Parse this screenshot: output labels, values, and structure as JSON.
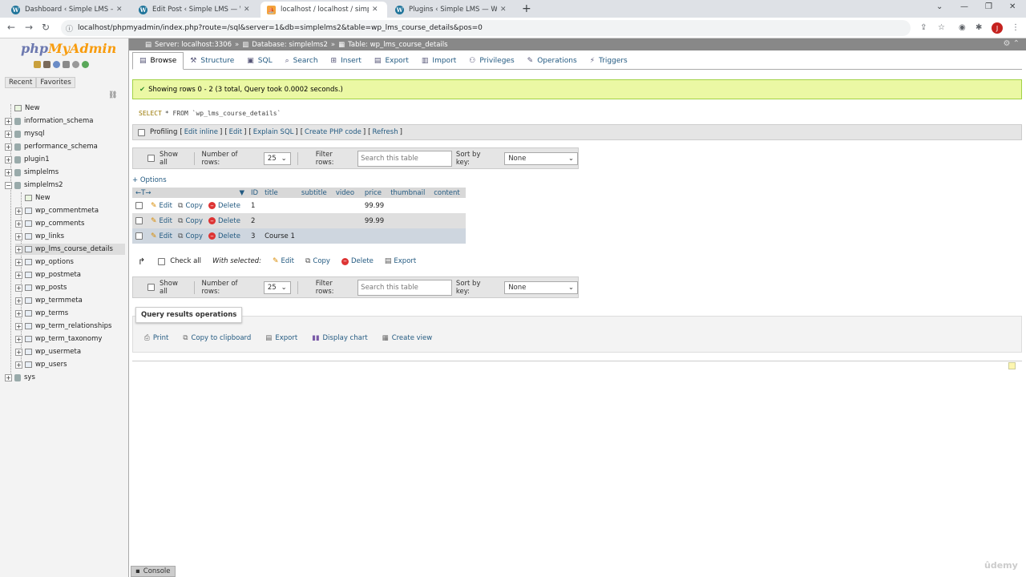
{
  "browser": {
    "tabs": [
      {
        "label": "Dashboard ‹ Simple LMS — Wor",
        "icon": "wordpress-icon",
        "active": false
      },
      {
        "label": "Edit Post ‹ Simple LMS — WordP",
        "icon": "wordpress-icon",
        "active": false
      },
      {
        "label": "localhost / localhost / simplelms:",
        "icon": "phpmyadmin-icon",
        "active": true
      },
      {
        "label": "Plugins ‹ Simple LMS — WordPre",
        "icon": "wordpress-icon",
        "active": false
      }
    ],
    "url": "localhost/phpmyadmin/index.php?route=/sql&server=1&db=simplelms2&table=wp_lms_course_details&pos=0",
    "profile_initial": "J"
  },
  "sidebar": {
    "logo_php": "php",
    "logo_myadmin": "MyAdmin",
    "tabs": [
      "Recent",
      "Favorites"
    ],
    "tree": [
      {
        "label": "New",
        "level": 0,
        "type": "new"
      },
      {
        "label": "information_schema",
        "level": 0,
        "type": "db"
      },
      {
        "label": "mysql",
        "level": 0,
        "type": "db"
      },
      {
        "label": "performance_schema",
        "level": 0,
        "type": "db"
      },
      {
        "label": "plugin1",
        "level": 0,
        "type": "db"
      },
      {
        "label": "simplelms",
        "level": 0,
        "type": "db"
      },
      {
        "label": "simplelms2",
        "level": 0,
        "type": "db-open"
      },
      {
        "label": "New",
        "level": 1,
        "type": "new"
      },
      {
        "label": "wp_commentmeta",
        "level": 1,
        "type": "table"
      },
      {
        "label": "wp_comments",
        "level": 1,
        "type": "table"
      },
      {
        "label": "wp_links",
        "level": 1,
        "type": "table"
      },
      {
        "label": "wp_lms_course_details",
        "level": 1,
        "type": "table",
        "selected": true
      },
      {
        "label": "wp_options",
        "level": 1,
        "type": "table"
      },
      {
        "label": "wp_postmeta",
        "level": 1,
        "type": "table"
      },
      {
        "label": "wp_posts",
        "level": 1,
        "type": "table"
      },
      {
        "label": "wp_termmeta",
        "level": 1,
        "type": "table"
      },
      {
        "label": "wp_terms",
        "level": 1,
        "type": "table"
      },
      {
        "label": "wp_term_relationships",
        "level": 1,
        "type": "table"
      },
      {
        "label": "wp_term_taxonomy",
        "level": 1,
        "type": "table"
      },
      {
        "label": "wp_usermeta",
        "level": 1,
        "type": "table"
      },
      {
        "label": "wp_users",
        "level": 1,
        "type": "table"
      },
      {
        "label": "sys",
        "level": 0,
        "type": "db"
      }
    ]
  },
  "breadcrumb": {
    "server": "Server: localhost:3306",
    "database": "Database: simplelms2",
    "table": "Table: wp_lms_course_details"
  },
  "menu": [
    {
      "label": "Browse",
      "icon": "browse-icon",
      "active": true
    },
    {
      "label": "Structure",
      "icon": "structure-icon"
    },
    {
      "label": "SQL",
      "icon": "sql-icon"
    },
    {
      "label": "Search",
      "icon": "search-icon"
    },
    {
      "label": "Insert",
      "icon": "insert-icon"
    },
    {
      "label": "Export",
      "icon": "export-icon"
    },
    {
      "label": "Import",
      "icon": "import-icon"
    },
    {
      "label": "Privileges",
      "icon": "privileges-icon"
    },
    {
      "label": "Operations",
      "icon": "operations-icon"
    },
    {
      "label": "Triggers",
      "icon": "triggers-icon"
    }
  ],
  "result": {
    "message": "Showing rows 0 - 2 (3 total, Query took 0.0002 seconds.)",
    "sql_keyword": "SELECT",
    "sql_rest": "* FROM `wp_lms_course_details`",
    "profiling": "Profiling",
    "profiling_links": [
      "Edit inline",
      "Edit",
      "Explain SQL",
      "Create PHP code",
      "Refresh"
    ]
  },
  "nav": {
    "show_all": "Show all",
    "number_of_rows_label": "Number of rows:",
    "number_of_rows_value": "25",
    "filter_rows_label": "Filter rows:",
    "filter_placeholder": "Search this table",
    "sort_by_key_label": "Sort by key:",
    "sort_by_key_value": "None"
  },
  "table": {
    "options_label": "+ Options",
    "columns": [
      "ID",
      "title",
      "subtitle",
      "video",
      "price",
      "thumbnail",
      "content"
    ],
    "row_actions": {
      "edit": "Edit",
      "copy": "Copy",
      "delete": "Delete"
    },
    "rows": [
      {
        "ID": "1",
        "title": "",
        "subtitle": "",
        "video": "",
        "price": "99.99",
        "thumbnail": "",
        "content": ""
      },
      {
        "ID": "2",
        "title": "",
        "subtitle": "",
        "video": "",
        "price": "99.99",
        "thumbnail": "",
        "content": ""
      },
      {
        "ID": "3",
        "title": "Course 1",
        "subtitle": "",
        "video": "",
        "price": "",
        "thumbnail": "",
        "content": ""
      }
    ]
  },
  "with_selected": {
    "check_all": "Check all",
    "label": "With selected:",
    "edit": "Edit",
    "copy": "Copy",
    "delete": "Delete",
    "export": "Export"
  },
  "query_ops": {
    "title": "Query results operations",
    "items": [
      "Print",
      "Copy to clipboard",
      "Export",
      "Display chart",
      "Create view"
    ]
  },
  "console": "Console",
  "watermark": "ûdemy"
}
